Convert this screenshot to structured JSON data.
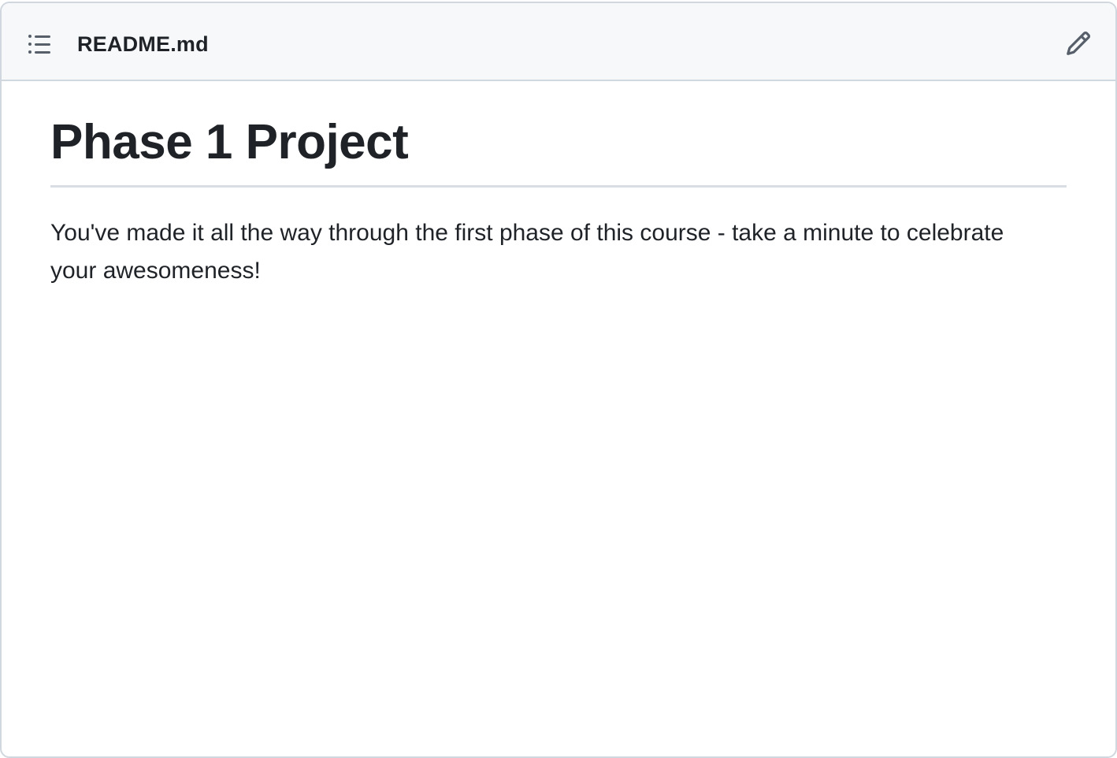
{
  "header": {
    "file_name": "README.md",
    "toc_icon": "list-unordered-icon",
    "edit_icon": "pencil-icon"
  },
  "content": {
    "heading": "Phase 1 Project",
    "paragraph": "You've made it all the way through the first phase of this course - take a minute to celebrate your awesomeness!"
  },
  "colors": {
    "header_bg": "#f6f8fa",
    "border": "#d0d7de",
    "text": "#1f2328",
    "icon": "#57606a"
  }
}
